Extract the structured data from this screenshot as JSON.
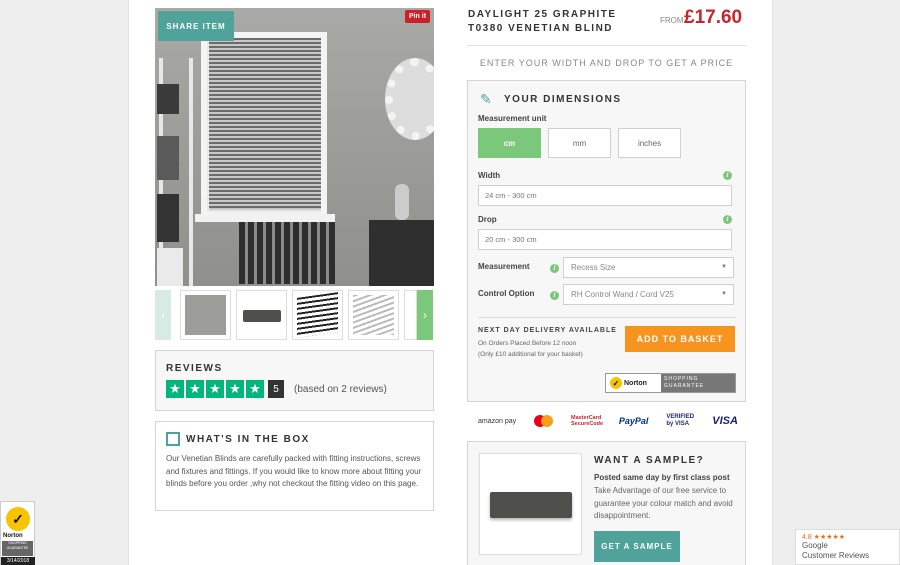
{
  "gallery": {
    "share_label": "SHARE ITEM",
    "pinit_label": "Pin it",
    "prev_arrow": "‹",
    "next_arrow": "›"
  },
  "reviews": {
    "title": "REVIEWS",
    "rating": 5,
    "star_glyph": "★",
    "score": "5",
    "based_on": "(based on 2 reviews)"
  },
  "in_box": {
    "title": "WHAT'S IN THE BOX",
    "body": "Our Venetian Blinds are carefully packed with fitting instructions, screws and fixtures and fittings.  If you would like to know more about fitting your blinds before you order ,why not checkout the fitting video on this page."
  },
  "product": {
    "title_line1": "DAYLIGHT 25 GRAPHITE",
    "title_line2": "T0380 VENETIAN BLIND",
    "from_label": "FROM",
    "price": "£17.60",
    "prompt": "ENTER YOUR WIDTH AND DROP TO GET A PRICE"
  },
  "dimensions": {
    "title": "YOUR DIMENSIONS",
    "unit_label": "Measurement unit",
    "units": [
      "cm",
      "mm",
      "inches"
    ],
    "active_unit": "cm",
    "width_label": "Width",
    "width_placeholder": "24 cm - 300 cm",
    "drop_label": "Drop",
    "drop_placeholder": "20 cm - 300 cm",
    "measurement_label": "Measurement",
    "measurement_value": "Recess Size",
    "control_label": "Control Option",
    "control_value": "RH Control Wand / Cord V25",
    "info_glyph": "i",
    "caret_glyph": "▼"
  },
  "delivery": {
    "title": "NEXT DAY DELIVERY AVAILABLE",
    "line1": "On Orders Placed Before 12 noon",
    "line2": "(Only £10 additional for your basket)",
    "basket_label": "ADD TO BASKET"
  },
  "norton_badge": {
    "name": "Norton",
    "tagline": "SHOPPING GUARANTEE",
    "check_glyph": "✓"
  },
  "payments": [
    "amazon pay",
    "MasterCard SecureCode",
    "PayPal",
    "VERIFIED by VISA",
    "VISA"
  ],
  "sample": {
    "title": "WANT A SAMPLE?",
    "posted": "Posted same day by first class post",
    "body": "Take Advantage of our free service to guarantee your colour match and avoid disappointment.",
    "button": "GET A SAMPLE"
  },
  "norton_seal": {
    "name": "Norton",
    "tagline": "SHOPPING GUARANTEE",
    "date": "3/14/2018"
  },
  "google_reviews": {
    "rating": "4.8 ★★★★★",
    "line1": "Google",
    "line2": "Customer Reviews"
  },
  "colors": {
    "teal": "#4fa39a",
    "green": "#7cc87a",
    "orange": "#f7941d",
    "price_red": "#c9252c",
    "trustpilot_green": "#00b67a"
  }
}
